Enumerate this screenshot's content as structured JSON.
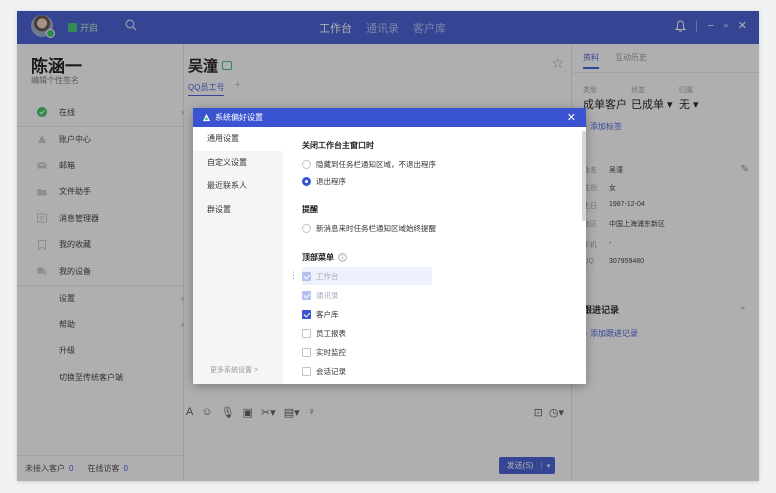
{
  "topbar": {
    "status": "开启",
    "nav": [
      "工作台",
      "通讯录",
      "客户库"
    ],
    "active_nav": 0,
    "controls": [
      "bell-icon",
      "minimize-icon",
      "maximize-icon",
      "close-icon"
    ]
  },
  "left": {
    "user_name": "陈涵一",
    "signature": "编辑个性签名",
    "menu": [
      {
        "label": "在线",
        "icon": "online-check-icon",
        "chevron": true
      },
      {
        "label": "账户中心",
        "icon": "account-icon"
      },
      {
        "label": "邮箱",
        "icon": "mail-icon"
      },
      {
        "label": "文件助手",
        "icon": "folder-icon"
      },
      {
        "label": "消息管理器",
        "icon": "message-manager-icon"
      },
      {
        "label": "我的收藏",
        "icon": "bookmark-icon"
      },
      {
        "label": "我的设备",
        "icon": "device-icon"
      },
      {
        "label": "设置",
        "chevron": true
      },
      {
        "label": "帮助",
        "chevron": true
      },
      {
        "label": "升级"
      },
      {
        "label": "切换至传统客户端"
      }
    ],
    "footer": {
      "unaccessed_label": "未接入客户",
      "unaccessed_count": "0",
      "online_visitor_label": "在线访客",
      "online_visitor_count": "0"
    }
  },
  "contact": {
    "name": "吴潼",
    "tabs": [
      "QQ员工号",
      "+"
    ],
    "send_label": "发送(S)"
  },
  "right": {
    "tabs": [
      "资料",
      "互动历史"
    ],
    "labels": [
      "类型",
      "状态",
      "归属"
    ],
    "values": [
      "成单客户",
      "已成单 ▾",
      "无 ▾"
    ],
    "add_tag": "+ 添加标签",
    "info": [
      {
        "k": "姓名",
        "v": "吴潼"
      },
      {
        "k": "性别",
        "v": "女"
      },
      {
        "k": "生日",
        "v": "1987-12-04"
      },
      {
        "k": "地区",
        "v": "中国上海浦东新区"
      }
    ],
    "contact_info": [
      {
        "k": "手机",
        "v": "-"
      },
      {
        "k": "QQ",
        "v": "307959480"
      }
    ],
    "follow_title": "跟进记录",
    "add_follow": "+ 添加跟进记录"
  },
  "dialog": {
    "title": "系统偏好设置",
    "nav": [
      "通用设置",
      "自定义设置",
      "最近联系人",
      "群设置"
    ],
    "active_nav": 0,
    "more": "更多系统设置 >",
    "close_section": "关闭工作台主窗口时",
    "close_options": [
      {
        "label": "隐藏到任务栏通知区域，不退出程序",
        "checked": false
      },
      {
        "label": "退出程序",
        "checked": true
      }
    ],
    "remind_section": "提醒",
    "remind_option": "新消息来时任务栏通知区域始终提醒",
    "topmenu_section": "顶部菜单",
    "topmenu_items": [
      {
        "label": "工作台",
        "state": "disabled"
      },
      {
        "label": "通讯录",
        "state": "disabled"
      },
      {
        "label": "客户库",
        "state": "checked"
      },
      {
        "label": "员工报表",
        "state": "unchecked"
      },
      {
        "label": "实时监控",
        "state": "unchecked"
      },
      {
        "label": "会话记录",
        "state": "unchecked"
      }
    ]
  },
  "colors": {
    "brand": "#3a54d1",
    "online": "#2fc25b"
  }
}
